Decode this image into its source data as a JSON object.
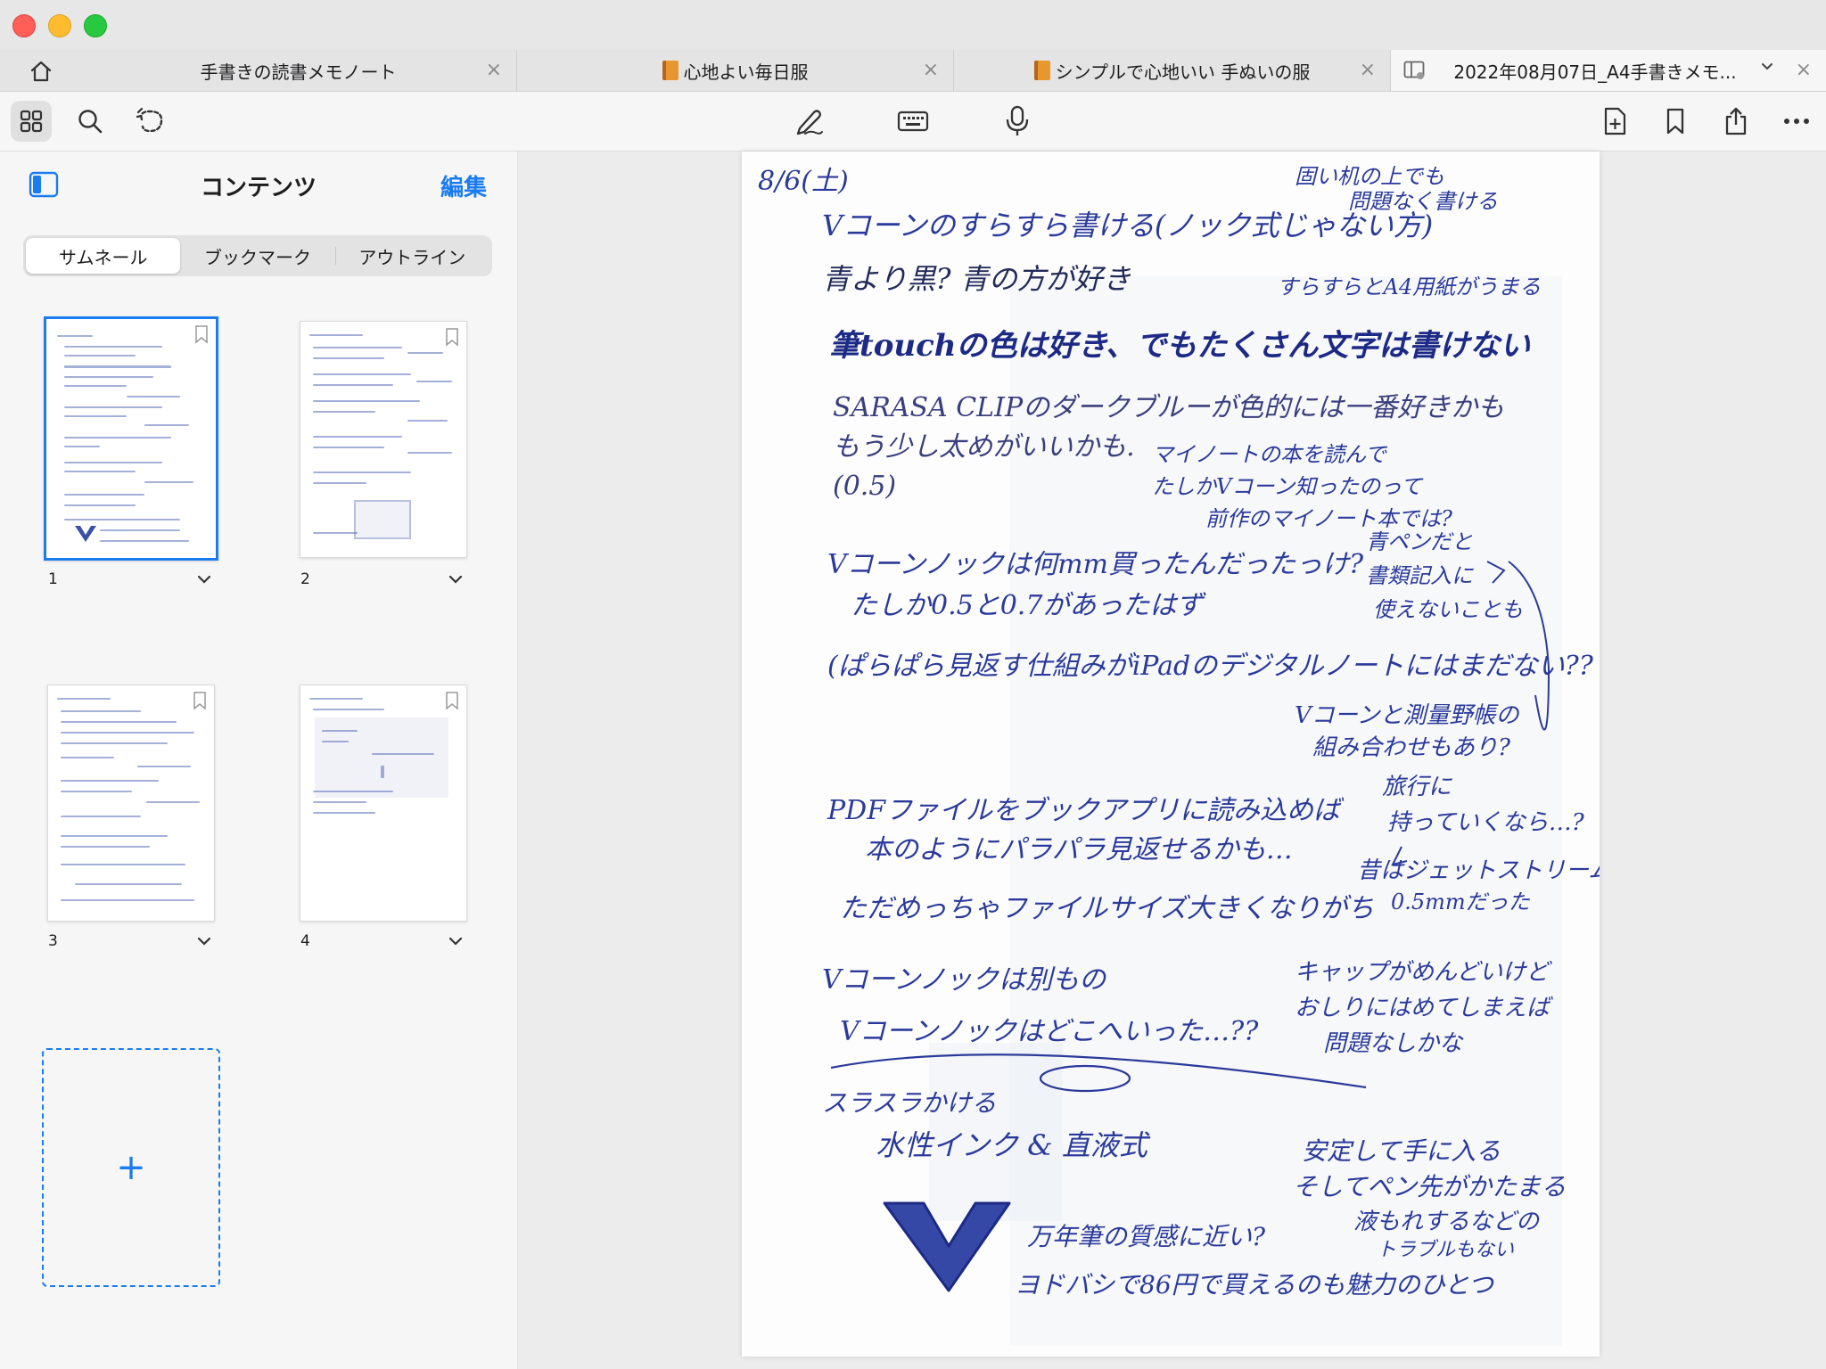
{
  "tabs": [
    {
      "title": "手書きの読書メモノート",
      "has_book_icon": false,
      "active": false
    },
    {
      "title": "心地よい毎日服",
      "has_book_icon": true,
      "active": false
    },
    {
      "title": "シンプルで心地いい 手ぬいの服",
      "has_book_icon": true,
      "active": false
    },
    {
      "title": "2022年08月07日_A4手書きメモ...",
      "has_book_icon": false,
      "active": true
    }
  ],
  "tab_close_glyph": "×",
  "sidebar": {
    "title": "コンテンツ",
    "edit_label": "編集",
    "segments": [
      "サムネール",
      "ブックマーク",
      "アウトライン"
    ],
    "selected_segment": "サムネール",
    "pages": [
      "1",
      "2",
      "3",
      "4"
    ],
    "selected_page": "1",
    "add_page_glyph": "+"
  },
  "icons": {
    "titlebar": [
      "home-icon"
    ],
    "toolbar_left": [
      "grid-icon",
      "search-icon",
      "lasso-icon"
    ],
    "toolbar_center": [
      "pen-icon",
      "keyboard-icon",
      "microphone-icon"
    ],
    "toolbar_right": [
      "add-page-icon",
      "bookmark-icon",
      "share-icon",
      "more-icon"
    ]
  },
  "colors": {
    "accent": "#1a7cf0",
    "ink": "#2a3a9a",
    "close_red": "#ff5f57",
    "minimize_yellow": "#febc2e",
    "zoom_green": "#28c840"
  },
  "note": {
    "lines": [
      "8/6(土)",
      "固い机の上でも",
      "問題なく書ける",
      "Vコーンのすらすら書ける(ノック式じゃない方)",
      "青より黒? 青の方が好き",
      "すらすらとA4用紙がうまる",
      "筆touchの色は好き、でもたくさん文字は書けない",
      "SARASA CLIPのダークブルーが色的には一番好きかも",
      "もう少し太めがいいかも.",
      "(0.5)",
      "マイノートの本を読んで",
      "たしかVコーン知ったのって",
      "前作のマイノート本では?",
      "青ペンだと",
      "書類記入に",
      "使えないことも",
      "Vコーンノックは何mm買ったんだったっけ?",
      "たしか0.5と0.7があったはず",
      "(ぱらぱら見返す仕組みがiPadのデジタルノートにはまだない??",
      "Vコーンと測量野帳の",
      "組み合わせもあり?",
      "PDFファイルをブックアプリに読み込めば",
      "本のようにパラパラ見返せるかも…",
      "旅行に",
      "持っていくなら…?",
      "昔はジェットストリーム",
      "0.5mmだった",
      "ただめっちゃファイルサイズ大きくなりがち",
      "Vコーンノックは別もの",
      "キャップがめんどいけど",
      "おしりにはめてしまえば",
      "問題なしかな",
      "Vコーンノックはどこへいった…??",
      "スラスラかける",
      "水性インク & 直液式",
      "安定して手に入る",
      "そしてペン先がかたまる",
      "液もれするなどの",
      "トラブルもない",
      "万年筆の質感に近い?",
      "ヨドバシで86円で買えるのも魅力のひとつ"
    ]
  }
}
